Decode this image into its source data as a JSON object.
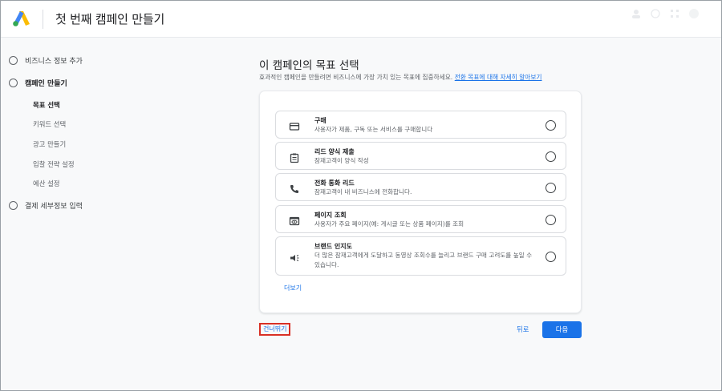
{
  "header": {
    "title": "첫 번째 캠페인 만들기"
  },
  "sidebar": {
    "steps": [
      {
        "label": "비즈니스 정보 추가"
      },
      {
        "label": "캠페인 만들기"
      },
      {
        "label": "결제 세부정보 입력"
      }
    ],
    "substeps": [
      {
        "label": "목표 선택"
      },
      {
        "label": "키워드 선택"
      },
      {
        "label": "광고 만들기"
      },
      {
        "label": "입찰 전략 설정"
      },
      {
        "label": "예산 설정"
      }
    ]
  },
  "main": {
    "title": "이 캠페인의 목표 선택",
    "subtitle": "효과적인 캠페인을 만들려면 비즈니스에 가장 가치 있는 목표에 집중하세요.",
    "subtitle_link": "전환 목표에 대해 자세히 알아보기"
  },
  "options": [
    {
      "icon": "credit-card-icon",
      "title": "구매",
      "desc": "사용자가 제품, 구독 또는 서비스를 구매합니다"
    },
    {
      "icon": "clipboard-icon",
      "title": "리드 양식 제출",
      "desc": "잠재고객이 양식 작성"
    },
    {
      "icon": "phone-icon",
      "title": "전화 통화 리드",
      "desc": "잠재고객이 내 비즈니스에 전화합니다."
    },
    {
      "icon": "page-view-icon",
      "title": "페이지 조회",
      "desc": "사용자가 주요 페이지(예: 게시글 또는 상품 페이지)를 조회"
    },
    {
      "icon": "megaphone-icon",
      "title": "브랜드 인지도",
      "desc": "더 많은 잠재고객에게 도달하고 동영상 조회수를 늘리고 브랜드 구매 고려도를 높일 수 있습니다."
    }
  ],
  "more_label": "더보기",
  "footer": {
    "skip_label": "건너뛰기",
    "back_label": "뒤로",
    "next_label": "다음"
  },
  "colors": {
    "accent": "#1a73e8",
    "highlight_border": "#d93025"
  }
}
